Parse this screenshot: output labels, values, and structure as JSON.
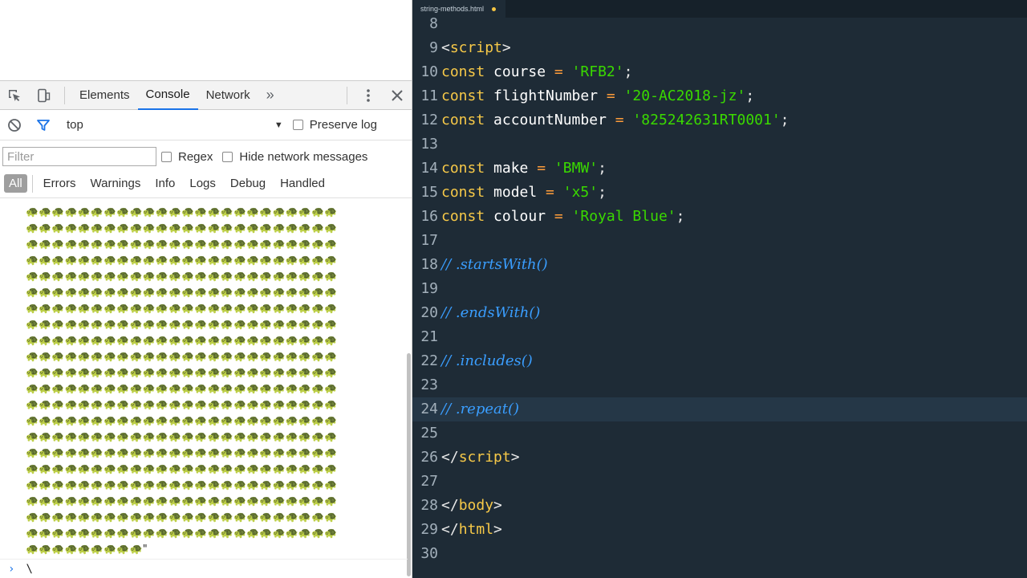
{
  "devtools": {
    "tabs": {
      "elements": "Elements",
      "console": "Console",
      "network": "Network",
      "more": "»"
    },
    "toolbar": {
      "context": "top",
      "preserve_log": "Preserve log"
    },
    "filter": {
      "placeholder": "Filter",
      "regex": "Regex",
      "hide_network": "Hide network messages"
    },
    "levels": {
      "all": "All",
      "errors": "Errors",
      "warnings": "Warnings",
      "info": "Info",
      "logs": "Logs",
      "debug": "Debug",
      "handled": "Handled"
    },
    "console": {
      "output_emoji": "🐢",
      "output_full_rows": 21,
      "output_per_row": 24,
      "output_last_row_count": 9,
      "output_end_quote": "\"",
      "prompt_input": "\\"
    }
  },
  "editor": {
    "file_tab": "string-methods.html",
    "lines": [
      {
        "n": "8",
        "t": []
      },
      {
        "n": "9",
        "t": [
          [
            "tag",
            "<"
          ],
          [
            "tagname",
            "script"
          ],
          [
            "tag",
            ">"
          ]
        ]
      },
      {
        "n": "10",
        "t": [
          [
            "kw",
            "const"
          ],
          [
            "id",
            " course "
          ],
          [
            "op",
            "="
          ],
          [
            "id",
            " "
          ],
          [
            "str",
            "'RFB2'"
          ],
          [
            "punc",
            ";"
          ]
        ]
      },
      {
        "n": "11",
        "t": [
          [
            "kw",
            "const"
          ],
          [
            "id",
            " flightNumber "
          ],
          [
            "op",
            "="
          ],
          [
            "id",
            " "
          ],
          [
            "str",
            "'20-AC2018-jz'"
          ],
          [
            "punc",
            ";"
          ]
        ]
      },
      {
        "n": "12",
        "t": [
          [
            "kw",
            "const"
          ],
          [
            "id",
            " accountNumber "
          ],
          [
            "op",
            "="
          ],
          [
            "id",
            " "
          ],
          [
            "str",
            "'825242631RT0001'"
          ],
          [
            "punc",
            ";"
          ]
        ]
      },
      {
        "n": "13",
        "t": []
      },
      {
        "n": "14",
        "t": [
          [
            "kw",
            "const"
          ],
          [
            "id",
            " make "
          ],
          [
            "op",
            "="
          ],
          [
            "id",
            " "
          ],
          [
            "str",
            "'BMW'"
          ],
          [
            "punc",
            ";"
          ]
        ]
      },
      {
        "n": "15",
        "t": [
          [
            "kw",
            "const"
          ],
          [
            "id",
            " model "
          ],
          [
            "op",
            "="
          ],
          [
            "id",
            " "
          ],
          [
            "str",
            "'x5'"
          ],
          [
            "punc",
            ";"
          ]
        ]
      },
      {
        "n": "16",
        "t": [
          [
            "kw",
            "const"
          ],
          [
            "id",
            " colour "
          ],
          [
            "op",
            "="
          ],
          [
            "id",
            " "
          ],
          [
            "str",
            "'Royal Blue'"
          ],
          [
            "punc",
            ";"
          ]
        ]
      },
      {
        "n": "17",
        "t": []
      },
      {
        "n": "18",
        "t": [
          [
            "cm",
            "// .startsWith()"
          ]
        ]
      },
      {
        "n": "19",
        "t": []
      },
      {
        "n": "20",
        "t": [
          [
            "cm",
            "// .endsWith()"
          ]
        ]
      },
      {
        "n": "21",
        "t": []
      },
      {
        "n": "22",
        "t": [
          [
            "cm",
            "// .includes()"
          ]
        ]
      },
      {
        "n": "23",
        "t": []
      },
      {
        "n": "24",
        "t": [
          [
            "cm",
            "// .repeat()"
          ]
        ],
        "active": true
      },
      {
        "n": "25",
        "t": []
      },
      {
        "n": "26",
        "t": [
          [
            "tag",
            "</"
          ],
          [
            "tagname",
            "script"
          ],
          [
            "tag",
            ">"
          ]
        ]
      },
      {
        "n": "27",
        "t": []
      },
      {
        "n": "28",
        "t": [
          [
            "tag",
            "</"
          ],
          [
            "tagname",
            "body"
          ],
          [
            "tag",
            ">"
          ]
        ]
      },
      {
        "n": "29",
        "t": [
          [
            "tag",
            "</"
          ],
          [
            "tagname",
            "html"
          ],
          [
            "tag",
            ">"
          ]
        ]
      },
      {
        "n": "30",
        "t": []
      }
    ]
  }
}
